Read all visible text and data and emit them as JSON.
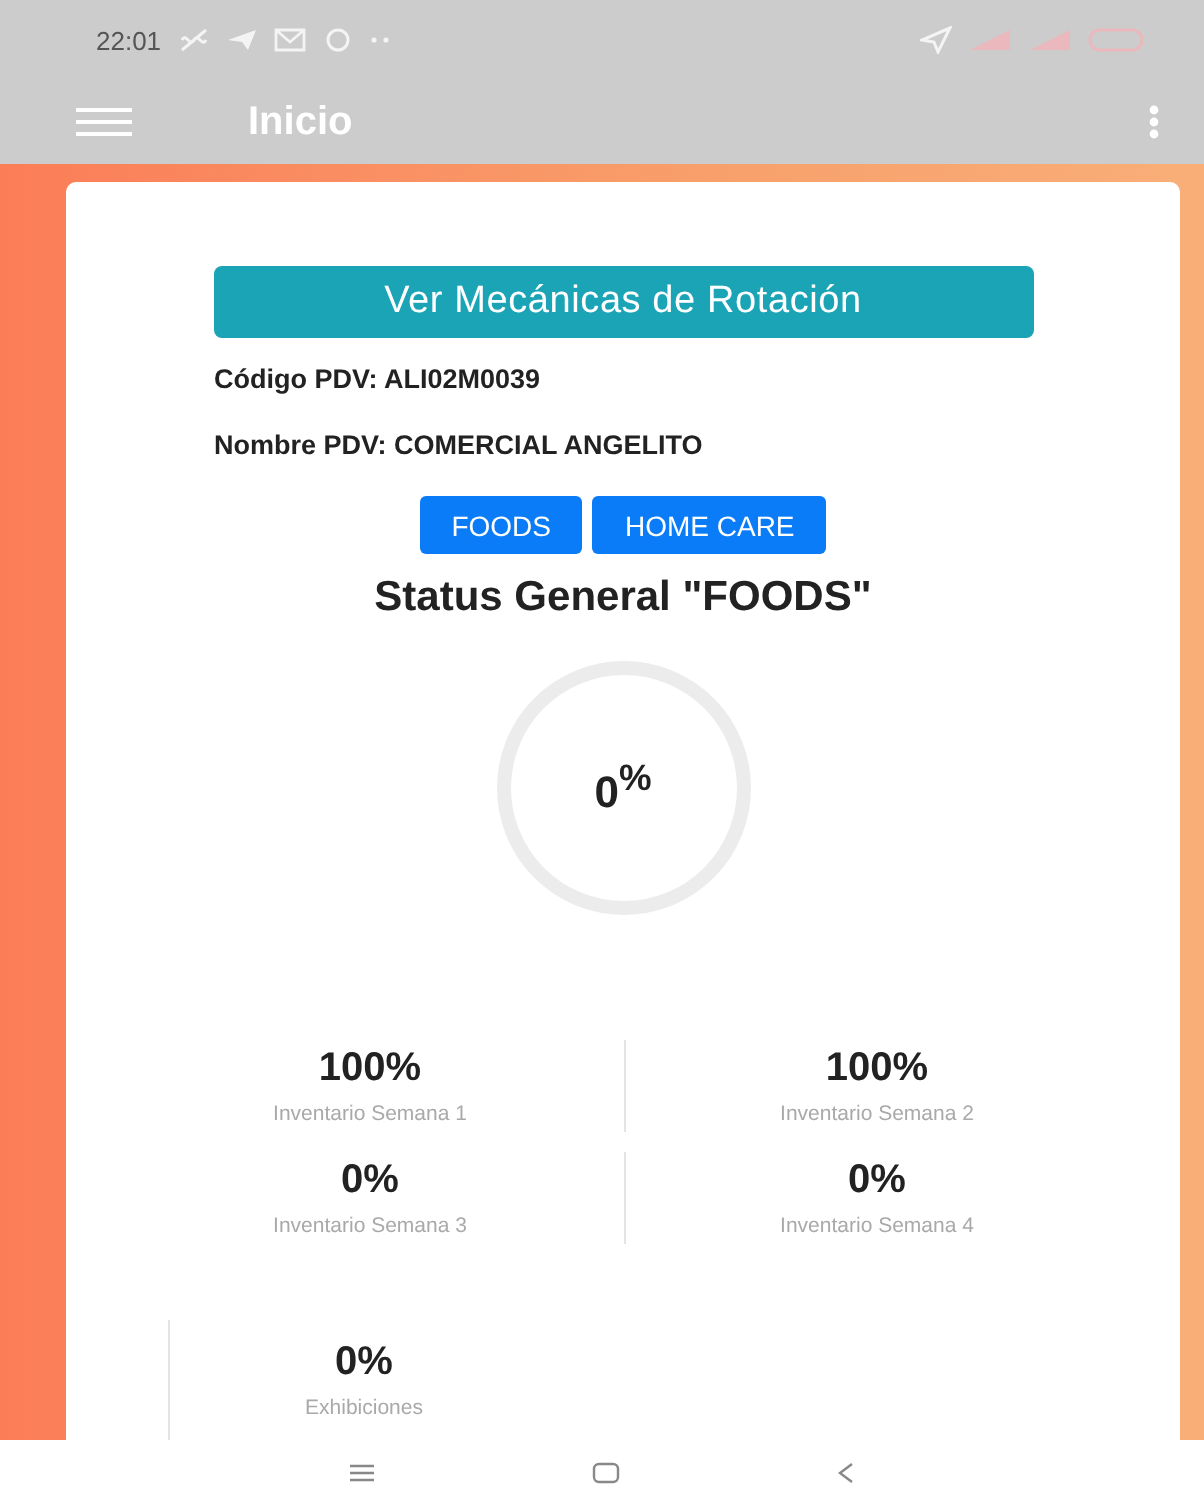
{
  "status_bar": {
    "time": "22:01"
  },
  "app_bar": {
    "title": "Inicio"
  },
  "rotation_button": "Ver Mecánicas de Rotación",
  "info": [
    "Código PDV: ALI02M0039",
    "Nombre PDV: COMERCIAL ANGELITO"
  ],
  "categories": [
    "FOODS",
    "HOME CARE"
  ],
  "status_title": "Status General \"FOODS\"",
  "gauge": {
    "value": "0",
    "unit": "%"
  },
  "stats": [
    {
      "value": "100%",
      "label": "Inventario Semana 1"
    },
    {
      "value": "100%",
      "label": "Inventario Semana 2"
    },
    {
      "value": "0%",
      "label": "Inventario Semana 3"
    },
    {
      "value": "0%",
      "label": "Inventario Semana 4"
    }
  ],
  "extra_stat": {
    "value": "0%",
    "label": "Exhibiciones"
  }
}
